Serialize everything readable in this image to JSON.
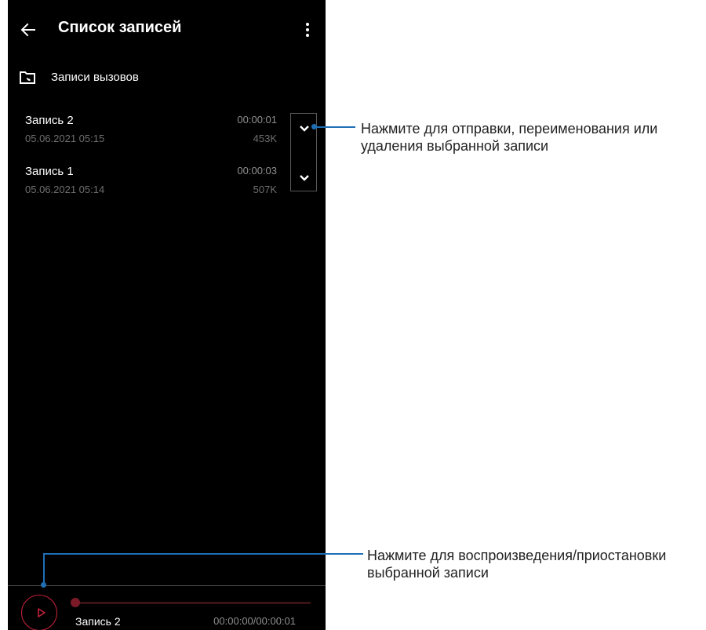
{
  "header": {
    "title": "Список записей",
    "back_icon": "arrow-left-icon",
    "menu_icon": "more-vertical-icon"
  },
  "folder": {
    "label": "Записи вызовов",
    "icon": "folder-phone-icon"
  },
  "recordings": [
    {
      "name": "Запись 2",
      "date": "05.06.2021 05:15",
      "duration": "00:00:01",
      "size": "453K"
    },
    {
      "name": "Запись 1",
      "date": "05.06.2021 05:14",
      "duration": "00:00:03",
      "size": "507K"
    }
  ],
  "player": {
    "track_name": "Запись 2",
    "time": "00:00:00/00:00:01",
    "progress": 0,
    "accent_color": "#c4223a"
  },
  "callouts": {
    "expand": {
      "line1": "Нажмите для отправки, переименования или",
      "line2": "удаления выбранной записи"
    },
    "play": {
      "line1": "Нажмите для воспроизведения/приостановки",
      "line2": "выбранной записи"
    },
    "color": "#1e6fb5"
  }
}
